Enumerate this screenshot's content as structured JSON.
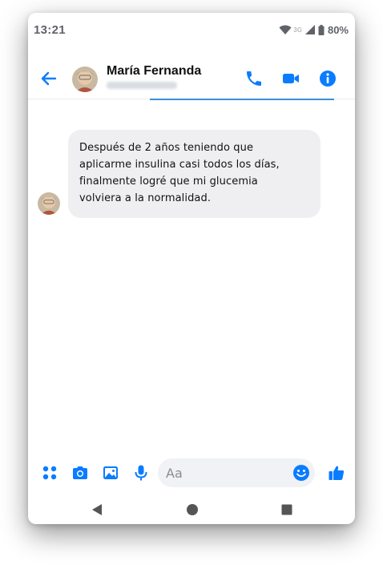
{
  "status": {
    "time": "13:21",
    "network": "3G",
    "battery": "80%"
  },
  "header": {
    "contact_name": "María Fernanda",
    "icons": [
      "back-arrow-icon",
      "phone-icon",
      "video-camera-icon",
      "info-icon"
    ]
  },
  "message": {
    "lines": [
      "Después de 2 años teniendo que",
      "aplicarme insulina casi todos los días,",
      "finalmente logré que mi glucemia",
      "volviera a la normalidad."
    ]
  },
  "composer": {
    "placeholder": "Aa",
    "icons": [
      "apps-icon",
      "camera-icon",
      "gallery-icon",
      "microphone-icon",
      "emoji-icon",
      "thumbs-up-icon"
    ]
  },
  "colors": {
    "accent": "#0a7cff",
    "bubble": "#efeff1",
    "status_text": "#5f6368"
  }
}
